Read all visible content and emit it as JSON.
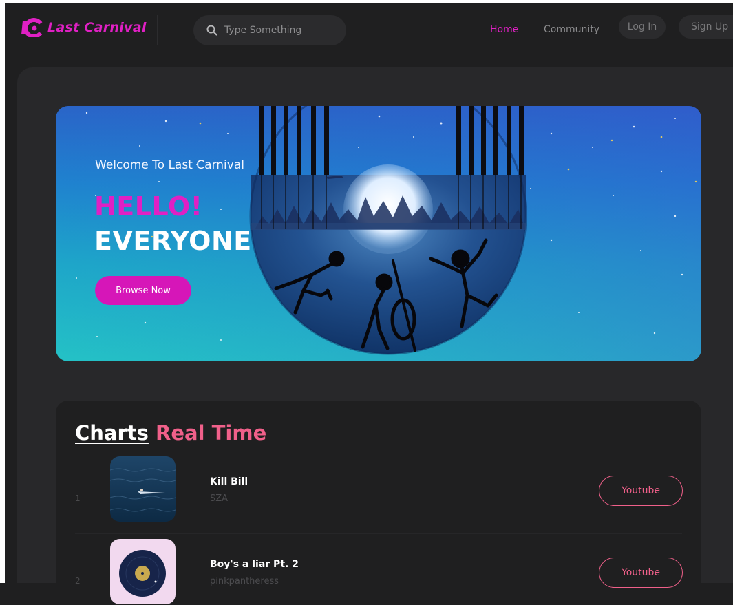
{
  "brand": {
    "name": "Last Carnival",
    "accent": "#e020c4",
    "pink": "#f0608a"
  },
  "search": {
    "placeholder": "Type Something"
  },
  "nav": {
    "home": "Home",
    "community": "Community",
    "login": "Log In",
    "signup": "Sign Up"
  },
  "hero": {
    "welcome": "Welcome To Last Carnival",
    "hello": "HELLO!",
    "everyone": "EVERYONE",
    "browse": "Browse Now"
  },
  "charts": {
    "title_white": "Charts",
    "title_pink": "Real Time",
    "items": [
      {
        "rank": "1",
        "title": "Kill Bill",
        "artist": "SZA",
        "button": "Youtube"
      },
      {
        "rank": "2",
        "title": "Boy's a liar Pt. 2",
        "artist": "pinkpantheress",
        "button": "Youtube"
      }
    ]
  }
}
